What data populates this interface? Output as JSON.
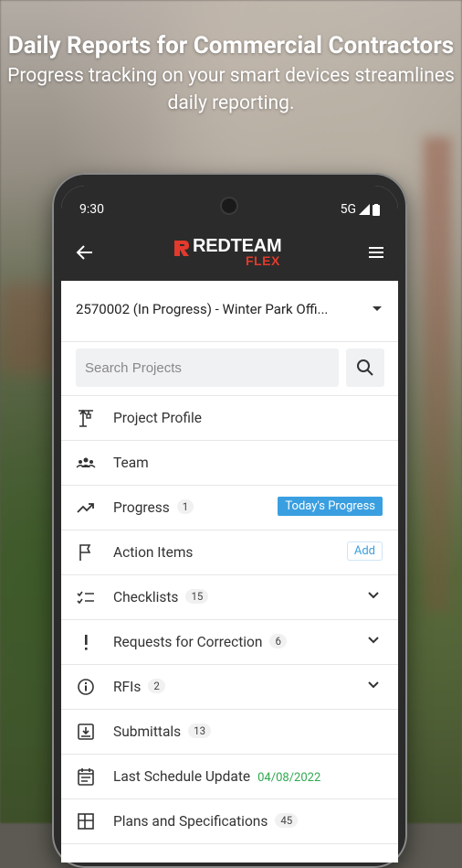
{
  "headline": {
    "title": "Daily Reports for Commercial Contractors",
    "subtitle": "Progress tracking on your smart devices streamlines daily reporting."
  },
  "status_bar": {
    "time": "9:30",
    "network": "5G"
  },
  "app": {
    "logo_text": "REDTEAM",
    "logo_sub": "FLEX",
    "brand_color": "#e23a2c"
  },
  "project": {
    "selected": "2570002 (In Progress) - Winter Park Offi..."
  },
  "search": {
    "placeholder": "Search Projects"
  },
  "menu": {
    "items": [
      {
        "label": "Project Profile",
        "icon": "crane-icon"
      },
      {
        "label": "Team",
        "icon": "team-icon"
      },
      {
        "label": "Progress",
        "count": "1",
        "icon": "trend-icon",
        "action": "Today's Progress"
      },
      {
        "label": "Action Items",
        "icon": "flag-icon",
        "action": "Add"
      },
      {
        "label": "Checklists",
        "count": "15",
        "icon": "checklist-icon"
      },
      {
        "label": "Requests for Correction",
        "count": "6",
        "icon": "exclamation-icon"
      },
      {
        "label": "RFIs",
        "count": "2",
        "icon": "info-icon"
      },
      {
        "label": "Submittals",
        "count": "13",
        "icon": "submittal-icon"
      },
      {
        "label": "Last Schedule Update",
        "date": "04/08/2022",
        "icon": "calendar-icon"
      },
      {
        "label": "Plans and Specifications",
        "count": "45",
        "icon": "plans-icon"
      }
    ]
  },
  "colors": {
    "accent": "#3a9fe0",
    "date_green": "#2fa84f",
    "appbar": "#2b2b2b"
  }
}
